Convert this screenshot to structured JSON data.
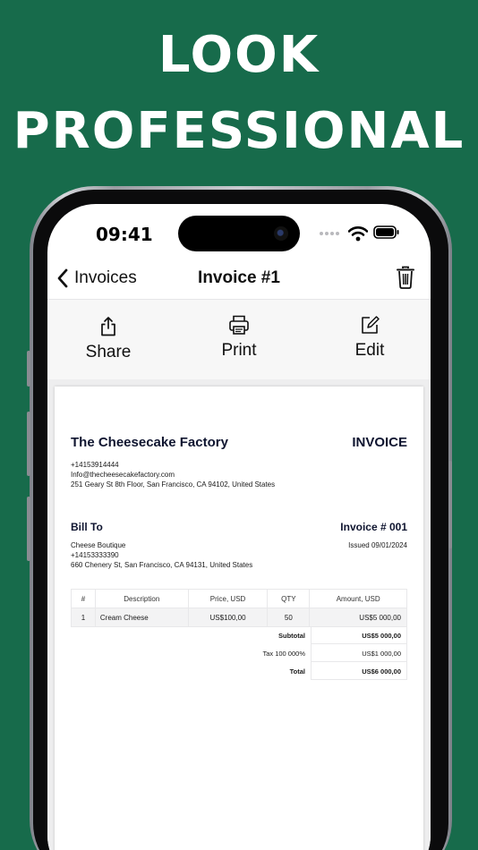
{
  "headline": {
    "line1": "LOOK",
    "line2": "PROFESSIONAL"
  },
  "status_bar": {
    "time": "09:41"
  },
  "nav": {
    "back_label": "Invoices",
    "title": "Invoice #1"
  },
  "toolbar": {
    "share_label": "Share",
    "print_label": "Print",
    "edit_label": "Edit"
  },
  "invoice": {
    "company_name": "The Cheesecake Factory",
    "doc_type": "INVOICE",
    "company_phone": "+14153914444",
    "company_email": "Info@thecheesecakefactory.com",
    "company_address": "251 Geary St 8th Floor, San Francisco, CA 94102, United States",
    "bill_to_label": "Bill To",
    "invoice_number": "Invoice # 001",
    "issued": "Issued 09/01/2024",
    "client_name": "Cheese Boutique",
    "client_phone": "+14153333390",
    "client_address": "660 Chenery St, San Francisco, CA 94131, United States",
    "columns": {
      "num": "#",
      "description": "Description",
      "price": "Price, USD",
      "qty": "QTY",
      "amount": "Amount, USD"
    },
    "items": [
      {
        "num": "1",
        "description": "Cream Cheese",
        "price": "US$100,00",
        "qty": "50",
        "amount": "US$5 000,00"
      }
    ],
    "totals": {
      "subtotal_label": "Subtotal",
      "subtotal_value": "US$5 000,00",
      "tax_label": "Tax 100 000%",
      "tax_value": "US$1 000,00",
      "total_label": "Total",
      "total_value": "US$6 000,00"
    }
  },
  "colors": {
    "background": "#176b4b",
    "text_dark": "#0f1530"
  },
  "icons": [
    "chevron-left-icon",
    "trash-icon",
    "share-icon",
    "printer-icon",
    "edit-icon",
    "wifi-icon",
    "battery-icon"
  ]
}
